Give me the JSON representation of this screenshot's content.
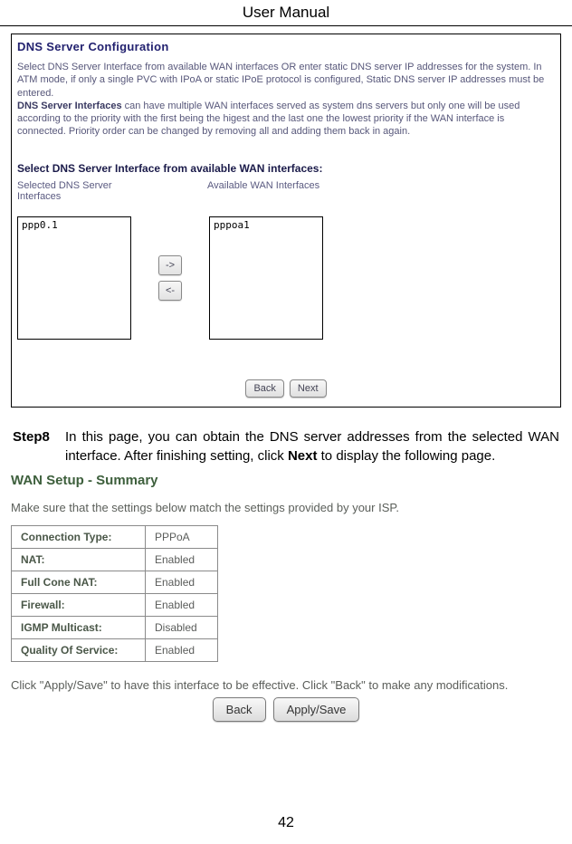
{
  "header": "User Manual",
  "dns": {
    "title": "DNS Server Configuration",
    "desc1a": "Select DNS Server Interface from available WAN interfaces OR enter static DNS server IP addresses for the system. In ATM mode, if only a single PVC with IPoA or static IPoE protocol is configured, Static DNS server IP addresses must be entered.",
    "desc2_bold": "DNS Server Interfaces",
    "desc2_rest": " can have multiple WAN interfaces served as system dns servers but only one will be used according to the priority with the first being the higest and the last one the lowest priority if the WAN interface is connected. Priority order can be changed by removing all and adding them back in again.",
    "selectHeading": "Select DNS Server Interface from available WAN interfaces:",
    "label_selected": "Selected DNS Server Interfaces",
    "label_available": "Available WAN Interfaces",
    "list_selected": "ppp0.1",
    "list_available": "pppoa1",
    "arrow_right": "->",
    "arrow_left": "<-",
    "btn_back": "Back",
    "btn_next": "Next"
  },
  "step": {
    "label": "Step8",
    "text_a": "In this page, you can obtain the DNS server addresses from the selected WAN interface. After finishing setting, click ",
    "text_bold": "Next",
    "text_b": " to display the following page."
  },
  "wan": {
    "title": "WAN Setup - Summary",
    "intro": "Make sure that the settings below match the settings provided by your ISP.",
    "rows": [
      {
        "k": "Connection Type:",
        "v": "PPPoA"
      },
      {
        "k": "NAT:",
        "v": "Enabled"
      },
      {
        "k": "Full Cone NAT:",
        "v": "Enabled"
      },
      {
        "k": "Firewall:",
        "v": "Enabled"
      },
      {
        "k": "IGMP Multicast:",
        "v": "Disabled"
      },
      {
        "k": "Quality Of Service:",
        "v": "Enabled"
      }
    ],
    "footer": "Click \"Apply/Save\" to have this interface to be effective. Click \"Back\" to make any modifications.",
    "btn_back": "Back",
    "btn_apply": "Apply/Save"
  },
  "pageNum": "42"
}
